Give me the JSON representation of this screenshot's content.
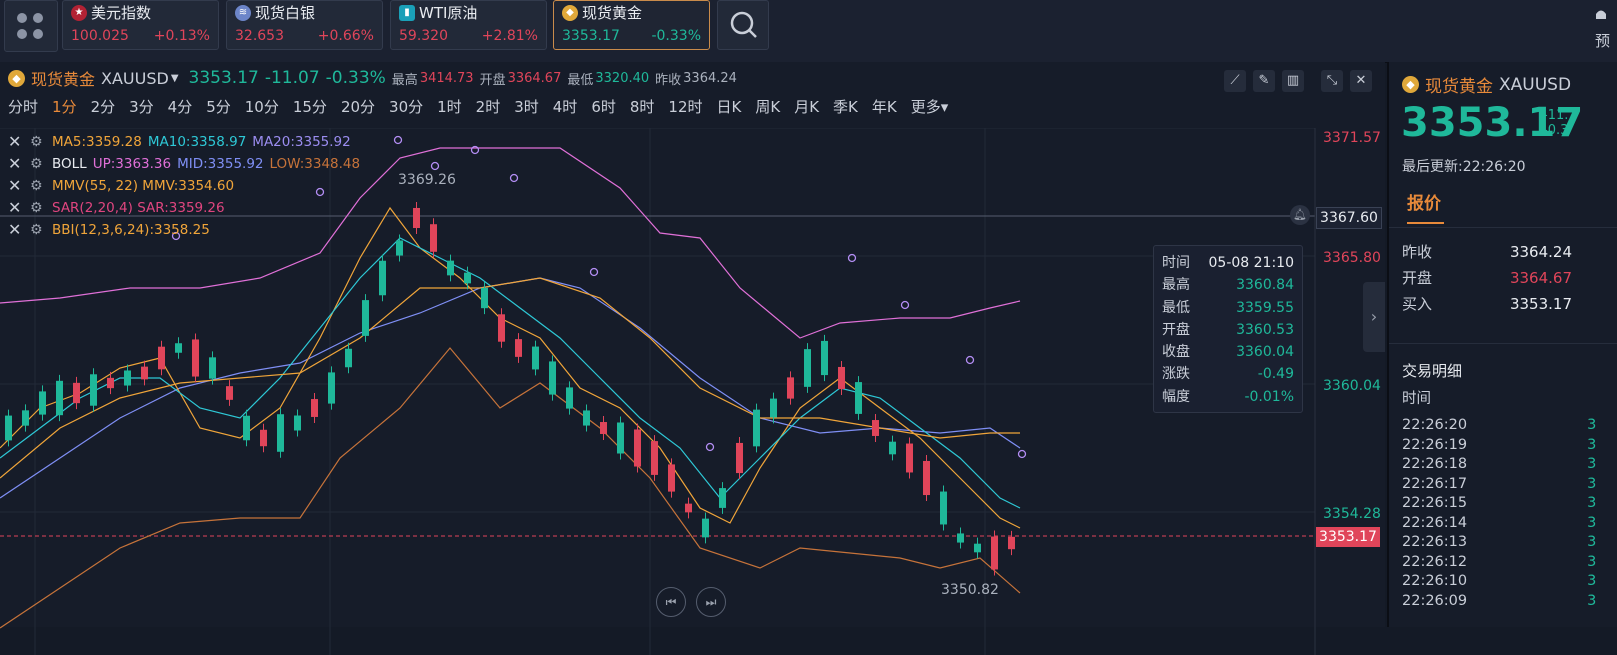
{
  "tickers": [
    {
      "name": "美元指数",
      "price": "100.025",
      "change": "+0.13%",
      "icon": "us-flag-icon",
      "color": "#e0455a"
    },
    {
      "name": "现货白银",
      "price": "32.653",
      "change": "+0.66%",
      "icon": "silver-icon",
      "color": "#e0455a"
    },
    {
      "name": "WTI原油",
      "price": "59.320",
      "change": "+2.81%",
      "icon": "oil-icon",
      "color": "#e0455a"
    },
    {
      "name": "现货黄金",
      "price": "3353.17",
      "change": "-0.33%",
      "icon": "gold-icon",
      "color": "#1fb89a"
    }
  ],
  "top_right_label": "预",
  "header": {
    "name": "现货黄金",
    "symbol": "XAUUSD",
    "price": "3353.17",
    "change": "-11.07",
    "pct": "-0.33%",
    "high_label": "最高",
    "high": "3414.73",
    "open_label": "开盘",
    "open": "3364.67",
    "low_label": "最低",
    "low": "3320.40",
    "prev_label": "昨收",
    "prev": "3364.24"
  },
  "periods": [
    "分时",
    "1分",
    "2分",
    "3分",
    "4分",
    "5分",
    "10分",
    "15分",
    "20分",
    "30分",
    "1时",
    "2时",
    "3时",
    "4时",
    "6时",
    "8时",
    "12时",
    "日K",
    "周K",
    "月K",
    "季K",
    "年K",
    "更多"
  ],
  "selected_period": "1分",
  "indicators": {
    "ma": {
      "ma5": "MA5:3359.28",
      "ma10": "MA10:3358.97",
      "ma20": "MA20:3355.92"
    },
    "boll": {
      "name": "BOLL",
      "up": "UP:3363.36",
      "mid": "MID:3355.92",
      "low": "LOW:3348.48"
    },
    "mmv": "MMV(55, 22) MMV:3354.60",
    "sar": "SAR(2,20,4) SAR:3359.26",
    "bbi": "BBI(12,3,6,24):3358.25"
  },
  "chart": {
    "axis": [
      "3371.57",
      "3367.60",
      "3365.80",
      "3360.04",
      "3354.28",
      "3353.17"
    ],
    "peak_label": "3369.26",
    "trough_label": "3350.82"
  },
  "tooltip": [
    {
      "k": "时间",
      "v": "05-08 21:10"
    },
    {
      "k": "最高",
      "v": "3360.84"
    },
    {
      "k": "最低",
      "v": "3359.55"
    },
    {
      "k": "开盘",
      "v": "3360.53"
    },
    {
      "k": "收盘",
      "v": "3360.04"
    },
    {
      "k": "涨跌",
      "v": "-0.49"
    },
    {
      "k": "幅度",
      "v": "-0.01%"
    }
  ],
  "side": {
    "name": "现货黄金",
    "symbol": "XAUUSD",
    "price": "3353.17",
    "change": "-11.",
    "pct": "-0.3",
    "updated": "最后更新:22:26:20",
    "tab": "报价",
    "quote": [
      {
        "k": "昨收",
        "v": "3364.24",
        "c": "#e8ebf0"
      },
      {
        "k": "开盘",
        "v": "3364.67",
        "c": "#e0455a"
      },
      {
        "k": "买入",
        "v": "3353.17",
        "c": "#e8ebf0"
      }
    ],
    "trades_title": "交易明细",
    "time_header": "时间",
    "times": [
      "22:26:20",
      "22:26:19",
      "22:26:18",
      "22:26:17",
      "22:26:15",
      "22:26:14",
      "22:26:13",
      "22:26:12",
      "22:26:10",
      "22:26:09"
    ],
    "trade_val": "3"
  }
}
